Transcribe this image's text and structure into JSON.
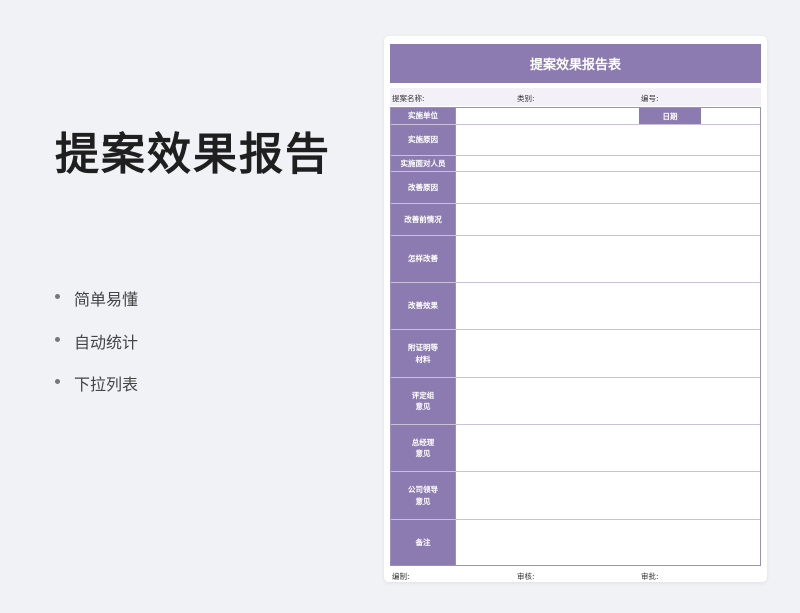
{
  "promo": {
    "title": "提案效果报告",
    "features": [
      "简单易懂",
      "自动统计",
      "下拉列表"
    ]
  },
  "sheet": {
    "title": "提案效果报告表",
    "meta": {
      "name_label": "提案名称:",
      "category_label": "类别:",
      "number_label": "编号:"
    },
    "rows": [
      {
        "label": "实施单位",
        "date_label": "日期"
      },
      {
        "label": "实施原因"
      },
      {
        "label": "实施面对人员"
      },
      {
        "label": "改善原因"
      },
      {
        "label": "改善前情况"
      },
      {
        "label": "怎样改善"
      },
      {
        "label": "改善效果"
      },
      {
        "label": "附证明等\n材料"
      },
      {
        "label": "评定组\n意见"
      },
      {
        "label": "总经理\n意见"
      },
      {
        "label": "公司领导\n意见"
      },
      {
        "label": "备注"
      }
    ],
    "footer": {
      "prepared_label": "编制:",
      "reviewed_label": "审核:",
      "approved_label": "审批:"
    }
  },
  "colors": {
    "accent": "#8c7bb0",
    "background": "#f1f2f6"
  }
}
